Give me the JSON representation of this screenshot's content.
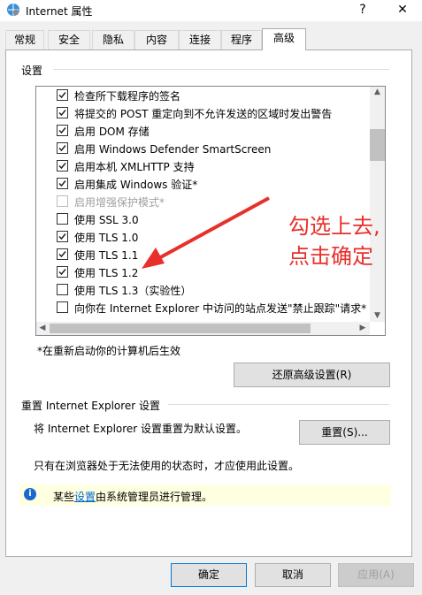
{
  "window": {
    "title": "Internet 属性",
    "help": "?",
    "close": "✕"
  },
  "tabs": [
    {
      "label": "常规"
    },
    {
      "label": "安全"
    },
    {
      "label": "隐私"
    },
    {
      "label": "内容"
    },
    {
      "label": "连接"
    },
    {
      "label": "程序"
    },
    {
      "label": "高级"
    }
  ],
  "settings": {
    "group_label": "设置",
    "items": [
      {
        "label": "检查所下载程序的签名",
        "checked": true,
        "disabled": false
      },
      {
        "label": "将提交的 POST 重定向到不允许发送的区域时发出警告",
        "checked": true,
        "disabled": false
      },
      {
        "label": "启用 DOM 存储",
        "checked": true,
        "disabled": false
      },
      {
        "label": "启用 Windows Defender SmartScreen",
        "checked": true,
        "disabled": false
      },
      {
        "label": "启用本机 XMLHTTP 支持",
        "checked": true,
        "disabled": false
      },
      {
        "label": "启用集成 Windows 验证*",
        "checked": true,
        "disabled": false
      },
      {
        "label": "启用增强保护模式*",
        "checked": false,
        "disabled": true
      },
      {
        "label": "使用 SSL 3.0",
        "checked": false,
        "disabled": false
      },
      {
        "label": "使用 TLS 1.0",
        "checked": true,
        "disabled": false
      },
      {
        "label": "使用 TLS 1.1",
        "checked": true,
        "disabled": false
      },
      {
        "label": "使用 TLS 1.2",
        "checked": true,
        "disabled": false
      },
      {
        "label": "使用 TLS 1.3（实验性）",
        "checked": false,
        "disabled": false
      },
      {
        "label": "向你在 Internet Explorer 中访问的站点发送\"禁止跟踪\"请求*",
        "checked": false,
        "disabled": false
      }
    ],
    "restart_note": "*在重新启动你的计算机后生效",
    "restore_button": "还原高级设置(R)"
  },
  "reset": {
    "group_label": "重置 Internet Explorer 设置",
    "description": "将 Internet Explorer 设置重置为默认设置。",
    "button": "重置(S)...",
    "note": "只有在浏览器处于无法使用的状态时，才应使用此设置。"
  },
  "info_bar": {
    "prefix": "某些",
    "link": "设置",
    "suffix": "由系统管理员进行管理。"
  },
  "footer": {
    "ok": "确定",
    "cancel": "取消",
    "apply": "应用(A)"
  },
  "annotation": {
    "line1": "勾选上去,",
    "line2": "点击确定",
    "color": "#e8302b"
  },
  "colors": {
    "accent": "#0078d7",
    "info_bg": "#ffffe1"
  }
}
